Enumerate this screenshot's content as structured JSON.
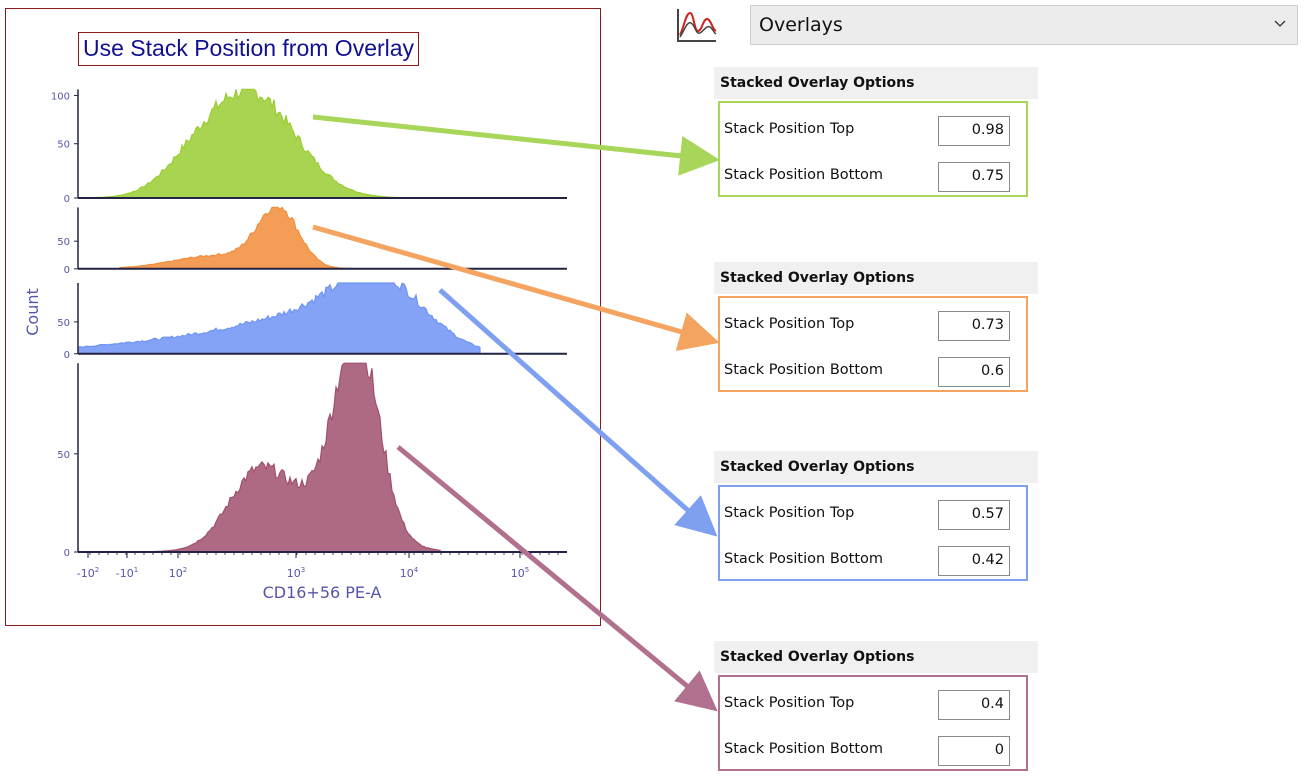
{
  "plot": {
    "title": "Use Stack Position from Overlay",
    "ylabel": "Count",
    "xlabel": "CD16+56 PE-A",
    "x_ticks": [
      {
        "base": "-10",
        "exp": "2"
      },
      {
        "base": "-10",
        "exp": "1"
      },
      {
        "base": "10",
        "exp": "2"
      },
      {
        "base": "10",
        "exp": "3"
      },
      {
        "base": "10",
        "exp": "4"
      },
      {
        "base": "10",
        "exp": "5"
      }
    ]
  },
  "chart_data": {
    "type": "area",
    "title": "Use Stack Position from Overlay",
    "xlabel": "CD16+56 PE-A",
    "ylabel": "Count",
    "x_scale": "biexponential",
    "series": [
      {
        "color": "#9acd32",
        "stack_top": 0.98,
        "stack_bottom": 0.75,
        "yticks": [
          "0",
          "50",
          "100"
        ]
      },
      {
        "color": "#f28c3a",
        "stack_top": 0.73,
        "stack_bottom": 0.6,
        "yticks": [
          "0",
          "50"
        ]
      },
      {
        "color": "#6e93f5",
        "stack_top": 0.57,
        "stack_bottom": 0.42,
        "yticks": [
          "0",
          "50"
        ]
      },
      {
        "color": "#a0506e",
        "stack_top": 0.4,
        "stack_bottom": 0,
        "yticks": [
          "0",
          "50"
        ]
      }
    ]
  },
  "toolbar": {
    "icon": "overlay-histogram-icon",
    "dropdown_value": "Overlays"
  },
  "panels": [
    {
      "header": "Stacked Overlay Options",
      "top_label": "Stack Position Top",
      "top_value": "0.98",
      "bottom_label": "Stack Position Bottom",
      "bottom_value": "0.75",
      "border_color": "#a8d65a"
    },
    {
      "header": "Stacked Overlay Options",
      "top_label": "Stack Position Top",
      "top_value": "0.73",
      "bottom_label": "Stack Position Bottom",
      "bottom_value": "0.6",
      "border_color": "#f4a460"
    },
    {
      "header": "Stacked Overlay Options",
      "top_label": "Stack Position Top",
      "top_value": "0.57",
      "bottom_label": "Stack Position Bottom",
      "bottom_value": "0.42",
      "border_color": "#7f9ff0"
    },
    {
      "header": "Stacked Overlay Options",
      "top_label": "Stack Position Top",
      "top_value": "0.4",
      "bottom_label": "Stack Position Bottom",
      "bottom_value": "0",
      "border_color": "#b0708e"
    }
  ]
}
